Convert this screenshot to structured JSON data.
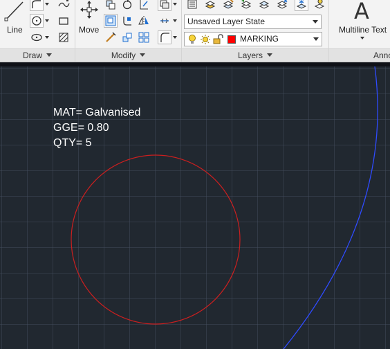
{
  "ribbon": {
    "panels": {
      "draw": {
        "label": "Draw"
      },
      "modify": {
        "label": "Modify"
      },
      "layers": {
        "label": "Layers"
      },
      "annotation": {
        "label": "Anno"
      }
    },
    "tools": {
      "line": {
        "label": "Line"
      },
      "move": {
        "label": "Move"
      },
      "multiline_text": {
        "label": "Multiline Text",
        "glyph": "A"
      }
    },
    "layer_state": {
      "value": "Unsaved Layer State"
    },
    "current_layer": {
      "value": "MARKING",
      "color": "#ff0000"
    }
  },
  "drawing": {
    "text_lines": [
      "MAT= Galvanised",
      "GGE= 0.80",
      "QTY= 5"
    ],
    "colors": {
      "background": "#212830",
      "small_circle": "#cc1f1f",
      "large_arc": "#2f4bff",
      "text": "#ffffff"
    }
  }
}
